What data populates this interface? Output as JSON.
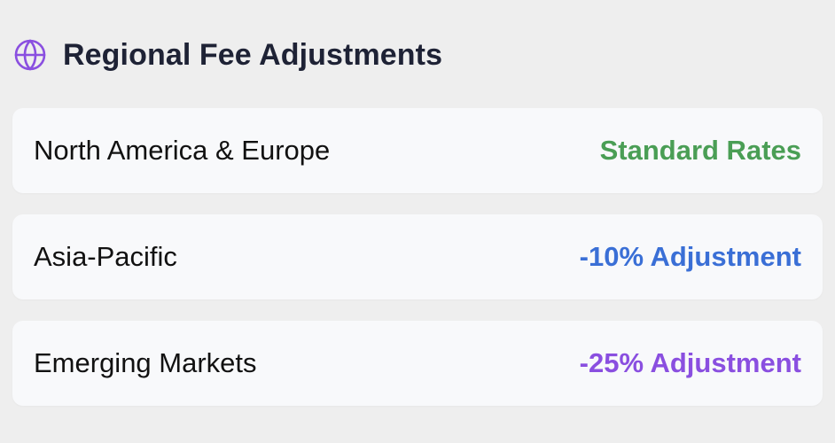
{
  "header": {
    "title": "Regional Fee Adjustments",
    "icon": "globe-icon",
    "icon_color": "#8a4fe0"
  },
  "regions": [
    {
      "label": "North America & Europe",
      "value": "Standard Rates",
      "color": "#4a9e55"
    },
    {
      "label": "Asia-Pacific",
      "value": "-10% Adjustment",
      "color": "#3a6fd6"
    },
    {
      "label": "Emerging Markets",
      "value": "-25% Adjustment",
      "color": "#8a4fe0"
    }
  ]
}
